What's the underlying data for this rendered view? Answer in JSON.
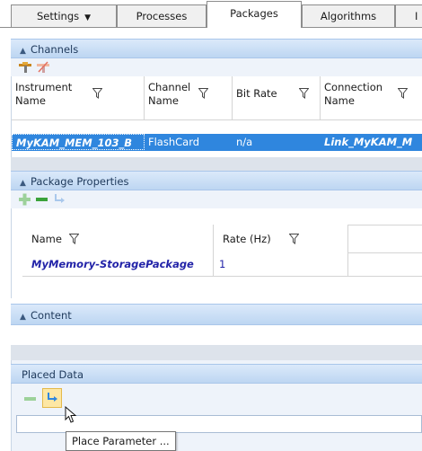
{
  "tabs": [
    {
      "label": "Settings",
      "has_dropdown": true
    },
    {
      "label": "Processes"
    },
    {
      "label": "Packages",
      "active": true
    },
    {
      "label": "Algorithms"
    },
    {
      "label": "I"
    }
  ],
  "channels": {
    "title": "Channels",
    "columns": [
      "Instrument Name",
      "Channel Name",
      "Bit Rate",
      "Connection Name"
    ],
    "column_lines": [
      [
        "Instrument",
        "Name"
      ],
      [
        "Channel",
        "Name"
      ],
      [
        "Bit Rate"
      ],
      [
        "Connection",
        "Name"
      ]
    ],
    "row": {
      "instrument": "MyKAM_MEM_103_B",
      "channel": "FlashCard",
      "bit_rate": "n/a",
      "connection": "Link_MyKAM_M"
    }
  },
  "package_properties": {
    "title": "Package Properties",
    "columns": [
      "Name",
      "Rate (Hz)"
    ],
    "row": {
      "name": "MyMemory-StoragePackage",
      "rate": "1"
    }
  },
  "content": {
    "title": "Content"
  },
  "placed_data": {
    "title": "Placed Data"
  },
  "tooltip": {
    "text": "Place Parameter ..."
  },
  "colors": {
    "selection": "#2f86de",
    "section_header": "#c9dcf4",
    "link_text": "#2223a8"
  }
}
